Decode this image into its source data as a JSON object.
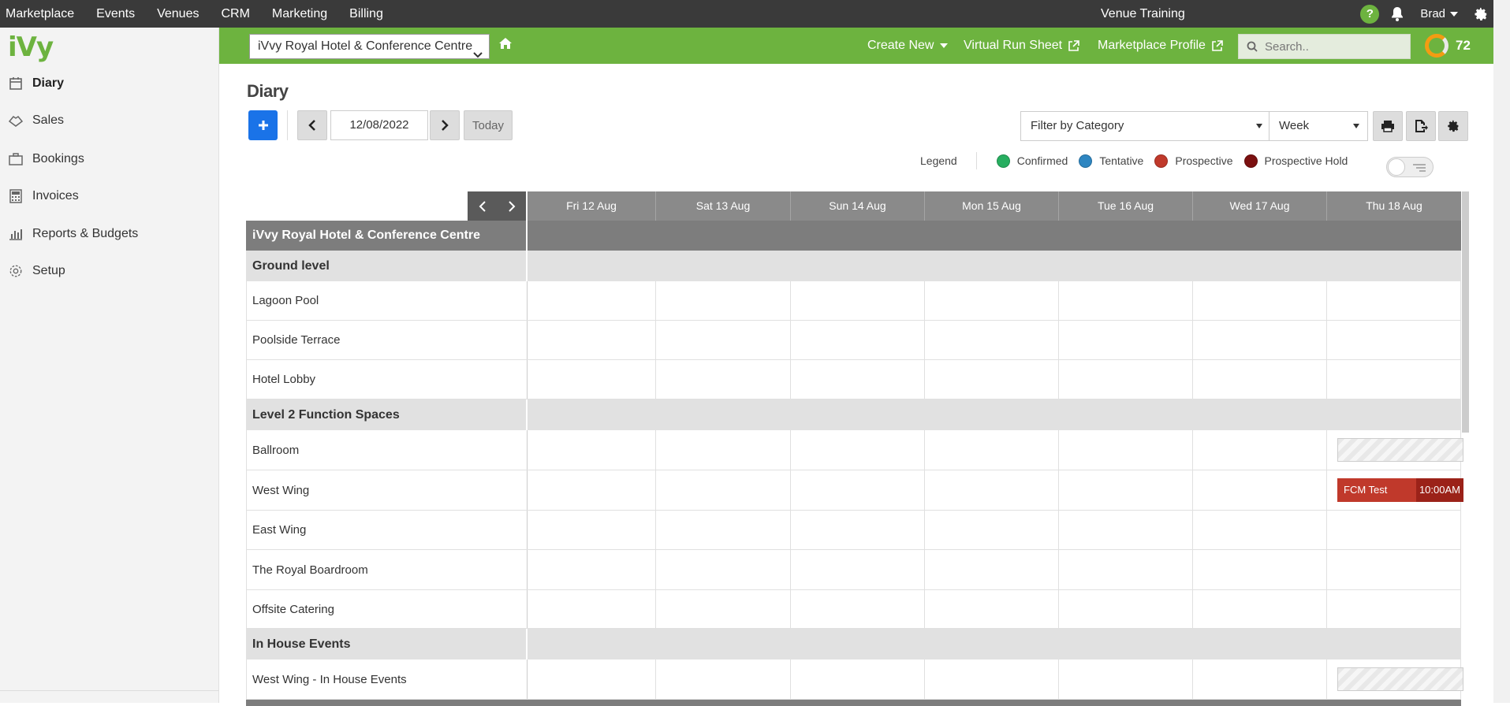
{
  "topnav": {
    "items": [
      "Marketplace",
      "Events",
      "Venues",
      "CRM",
      "Marketing",
      "Billing"
    ],
    "venue_title": "Venue Training",
    "help_label": "?",
    "user_name": "Brad"
  },
  "sidebar": {
    "logo": "iVy",
    "items": [
      {
        "label": "Diary",
        "icon": "calendar-icon"
      },
      {
        "label": "Sales",
        "icon": "handshake-icon"
      },
      {
        "label": "Bookings",
        "icon": "briefcase-icon"
      },
      {
        "label": "Invoices",
        "icon": "calculator-icon"
      },
      {
        "label": "Reports & Budgets",
        "icon": "bar-chart-icon"
      },
      {
        "label": "Setup",
        "icon": "gear-icon"
      }
    ]
  },
  "greenbar": {
    "venue_select": "iVvy Royal Hotel & Conference Centre",
    "create_new": "Create New",
    "virtual_run_sheet": "Virtual Run Sheet",
    "marketplace_profile": "Marketplace Profile",
    "search_placeholder": "Search..",
    "score": "72"
  },
  "diary": {
    "title": "Diary",
    "date": "12/08/2022",
    "today_label": "Today",
    "filter_label": "Filter by Category",
    "view_label": "Week",
    "legend": {
      "label": "Legend",
      "items": [
        {
          "label": "Confirmed",
          "color": "#27ae60"
        },
        {
          "label": "Tentative",
          "color": "#2e86c1"
        },
        {
          "label": "Prospective",
          "color": "#c0392b"
        },
        {
          "label": "Prospective Hold",
          "color": "#7b1010"
        }
      ]
    },
    "days": [
      "Fri 12 Aug",
      "Sat 13 Aug",
      "Sun 14 Aug",
      "Mon 15 Aug",
      "Tue 16 Aug",
      "Wed 17 Aug",
      "Thu 18 Aug"
    ],
    "venue": "iVvy Royal Hotel & Conference Centre",
    "categories": [
      {
        "name": "Ground level",
        "rooms": [
          "Lagoon Pool",
          "Poolside Terrace",
          "Hotel Lobby"
        ]
      },
      {
        "name": "Level 2 Function Spaces",
        "rooms": [
          "Ballroom",
          "West Wing",
          "East Wing",
          "The Royal Boardroom",
          "Offsite Catering"
        ]
      },
      {
        "name": "In House Events",
        "rooms": [
          "West Wing - In House Events"
        ]
      }
    ],
    "booking": {
      "name": "FCM Test",
      "time": "10:00AM",
      "room": "West Wing",
      "day": "Thu 18 Aug",
      "status": "Prospective"
    }
  }
}
